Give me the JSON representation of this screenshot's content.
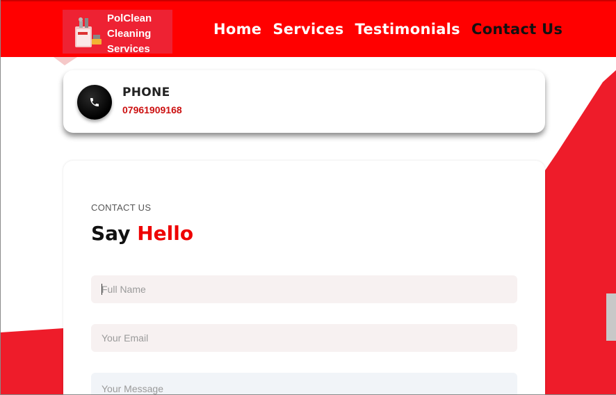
{
  "brand": {
    "lines": [
      "PolClean",
      "Cleaning",
      "Services"
    ],
    "logo_icon": "cleaning-bucket-icon",
    "colors": {
      "header_red": "#ff0000",
      "accent_red": "#ee0000",
      "logo_bg": "#ee2233"
    }
  },
  "nav": {
    "items": [
      {
        "label": "Home"
      },
      {
        "label": "Services"
      },
      {
        "label": "Testimonials"
      },
      {
        "label": "Contact Us"
      }
    ],
    "active": "Contact Us"
  },
  "phone_card": {
    "icon": "phone-icon",
    "title": "PHONE",
    "number": "07961909168"
  },
  "contact_form": {
    "eyebrow": "CONTACT US",
    "heading_prefix": "Say",
    "heading_accent": "Hello",
    "fields": {
      "name_placeholder": "Full Name",
      "email_placeholder": "Your Email",
      "message_placeholder": "Your Message"
    }
  }
}
